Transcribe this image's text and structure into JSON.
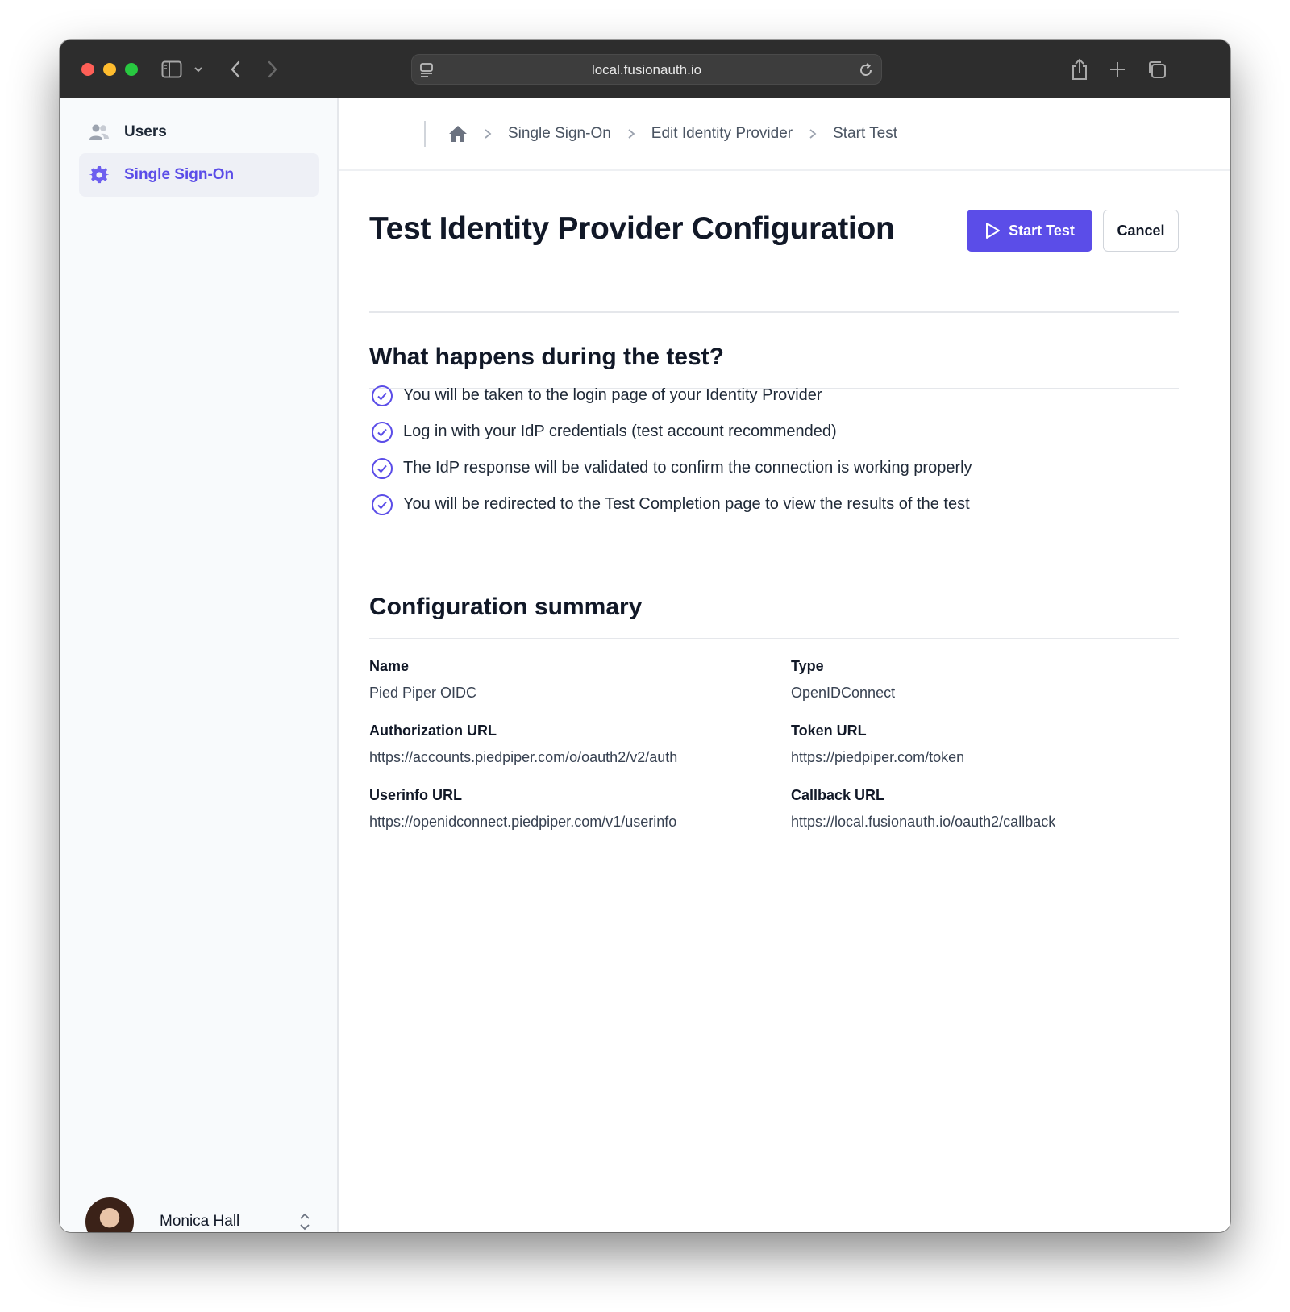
{
  "browser": {
    "url": "local.fusionauth.io"
  },
  "sidebar": {
    "items": [
      {
        "label": "Users",
        "icon": "users-icon",
        "active": false
      },
      {
        "label": "Single Sign-On",
        "icon": "gear-icon",
        "active": true
      }
    ],
    "user": {
      "name": "Monica Hall"
    }
  },
  "breadcrumb": {
    "items": [
      "Single Sign-On",
      "Edit Identity Provider",
      "Start Test"
    ]
  },
  "page": {
    "title": "Test Identity Provider Configuration",
    "start_button": "Start Test",
    "cancel_button": "Cancel"
  },
  "test_section": {
    "title": "What happens during the test?",
    "steps": [
      "You will be taken to the login page of your Identity Provider",
      "Log in with your IdP credentials (test account recommended)",
      "The IdP response will be validated to confirm the connection is working properly",
      "You will be redirected to the Test Completion page to view the results of the test"
    ]
  },
  "summary": {
    "title": "Configuration summary",
    "fields": [
      {
        "label": "Name",
        "value": "Pied Piper OIDC"
      },
      {
        "label": "Type",
        "value": "OpenIDConnect"
      },
      {
        "label": "Authorization URL",
        "value": "https://accounts.piedpiper.com/o/oauth2/v2/auth"
      },
      {
        "label": "Token URL",
        "value": "https://piedpiper.com/token"
      },
      {
        "label": "Userinfo URL",
        "value": "https://openidconnect.piedpiper.com/v1/userinfo"
      },
      {
        "label": "Callback URL",
        "value": "https://local.fusionauth.io/oauth2/callback"
      }
    ]
  },
  "colors": {
    "accent": "#5b4de8",
    "titlebar": "#2d2d2d",
    "sidebar_bg": "#f8fafc"
  }
}
